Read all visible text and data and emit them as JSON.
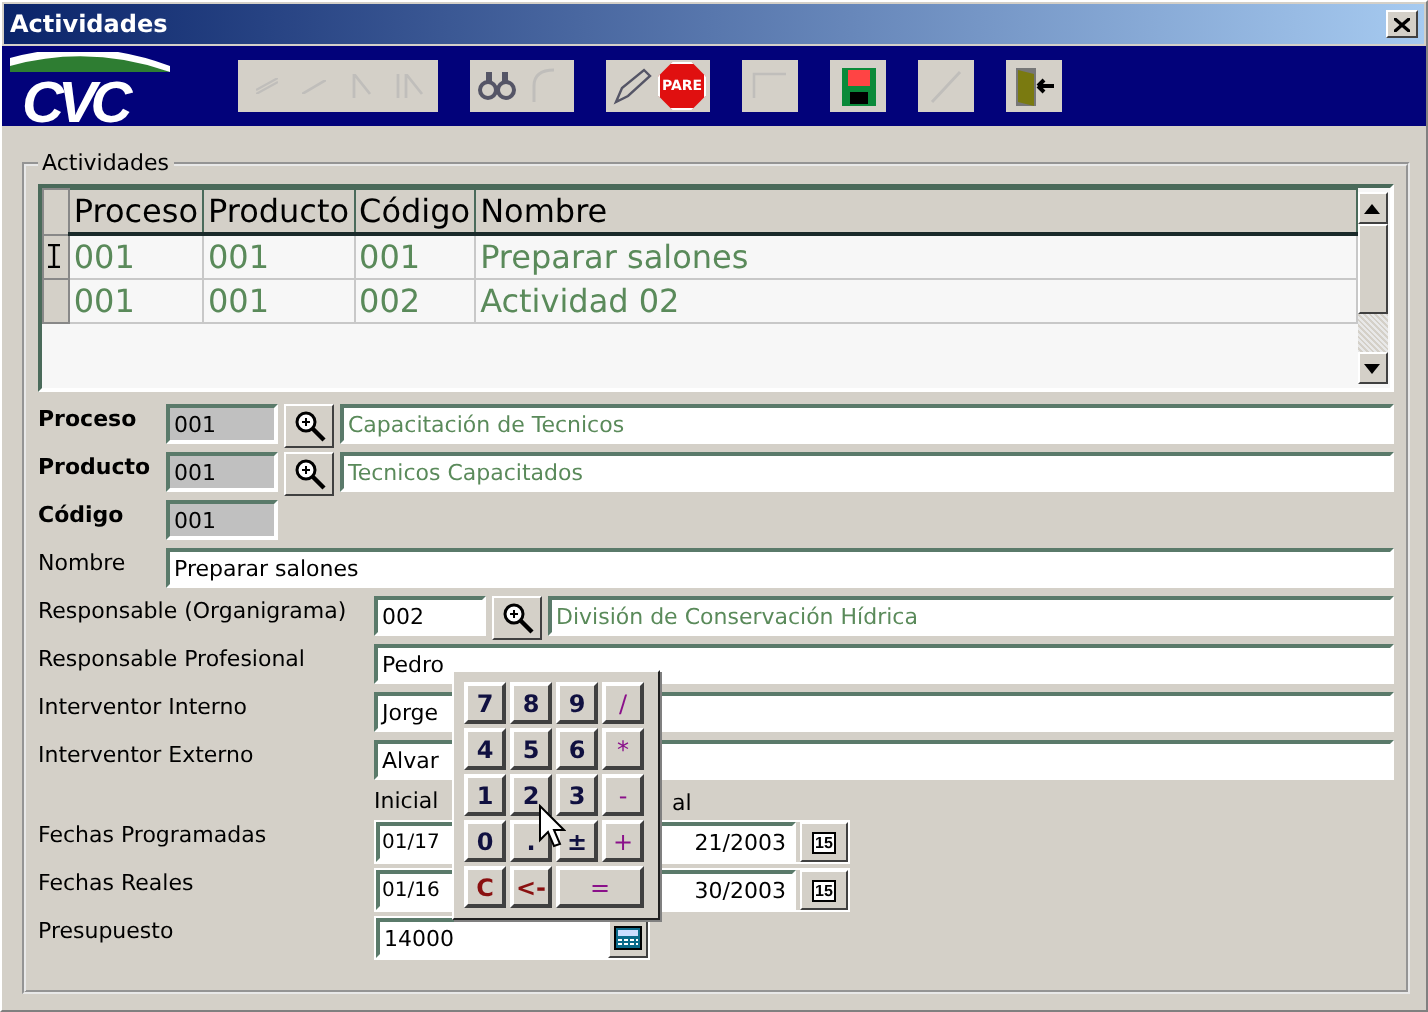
{
  "window": {
    "title": "Actividades"
  },
  "toolbar": {
    "logo": "CVC",
    "groups": [
      {
        "buttons": [
          {
            "kind": "first",
            "disabled": true
          },
          {
            "kind": "prev",
            "disabled": true
          },
          {
            "kind": "next",
            "disabled": true
          },
          {
            "kind": "last",
            "disabled": true
          }
        ]
      },
      {
        "buttons": [
          {
            "kind": "find",
            "disabled": false
          },
          {
            "kind": "undo",
            "disabled": true
          }
        ]
      },
      {
        "buttons": [
          {
            "kind": "edit",
            "disabled": false
          },
          {
            "kind": "stop",
            "disabled": false,
            "label": "PARE"
          }
        ]
      },
      {
        "buttons": [
          {
            "kind": "corner",
            "disabled": true
          }
        ]
      },
      {
        "buttons": [
          {
            "kind": "save",
            "disabled": false
          }
        ]
      },
      {
        "buttons": [
          {
            "kind": "cancel",
            "disabled": true
          }
        ]
      },
      {
        "buttons": [
          {
            "kind": "exit",
            "disabled": false
          }
        ]
      }
    ]
  },
  "group": {
    "title": "Actividades"
  },
  "grid": {
    "columns": [
      "Proceso",
      "Producto",
      "Código",
      "Nombre"
    ],
    "rows": [
      {
        "cells": [
          "001",
          "001",
          "001",
          "Preparar salones"
        ],
        "selected": true
      },
      {
        "cells": [
          "001",
          "001",
          "002",
          "Actividad 02"
        ],
        "selected": false
      }
    ]
  },
  "form": [
    {
      "kind": "key_lookup",
      "label": "Proceso",
      "code": "001",
      "description": "Capacitación de Tecnicos"
    },
    {
      "kind": "key_lookup",
      "label": "Producto",
      "code": "001",
      "description": "Tecnicos Capacitados"
    },
    {
      "kind": "key",
      "label": "Código",
      "code": "001"
    },
    {
      "kind": "name",
      "label": "Nombre",
      "value": "Preparar salones"
    },
    {
      "kind": "lookup",
      "label": "Responsable (Organigrama)",
      "code": "002",
      "description": "División de Conservación Hídrica"
    },
    {
      "kind": "text",
      "label": "Responsable Profesional",
      "value": "Pedro"
    },
    {
      "kind": "text",
      "label": "Interventor Interno",
      "value": "Jorge"
    },
    {
      "kind": "text",
      "label": "Interventor Externo",
      "value": "Alvar"
    },
    {
      "kind": "date_header",
      "start_label": "Inicial",
      "end_label": "al"
    },
    {
      "kind": "dates",
      "label": "Fechas Programadas",
      "start": "01/17",
      "end": "21/2003",
      "calendar": "15"
    },
    {
      "kind": "dates",
      "label": "Fechas Reales",
      "start": "01/16",
      "end": "30/2003",
      "calendar": "15"
    },
    {
      "kind": "amount",
      "label": "Presupuesto",
      "value": "14000"
    }
  ],
  "calculator": {
    "keys": [
      {
        "label": "7",
        "kind": "digit"
      },
      {
        "label": "8",
        "kind": "digit"
      },
      {
        "label": "9",
        "kind": "digit"
      },
      {
        "label": "/",
        "kind": "operator"
      },
      {
        "label": "4",
        "kind": "digit"
      },
      {
        "label": "5",
        "kind": "digit"
      },
      {
        "label": "6",
        "kind": "digit"
      },
      {
        "label": "*",
        "kind": "operator"
      },
      {
        "label": "1",
        "kind": "digit"
      },
      {
        "label": "2",
        "kind": "digit"
      },
      {
        "label": "3",
        "kind": "digit"
      },
      {
        "label": "-",
        "kind": "operator"
      },
      {
        "label": "0",
        "kind": "digit"
      },
      {
        "label": ".",
        "kind": "digit"
      },
      {
        "label": "±",
        "kind": "digit"
      },
      {
        "label": "+",
        "kind": "operator"
      },
      {
        "label": "C",
        "kind": "clear"
      },
      {
        "label": "<-",
        "kind": "clear"
      },
      {
        "label": "=",
        "kind": "equals"
      }
    ]
  }
}
